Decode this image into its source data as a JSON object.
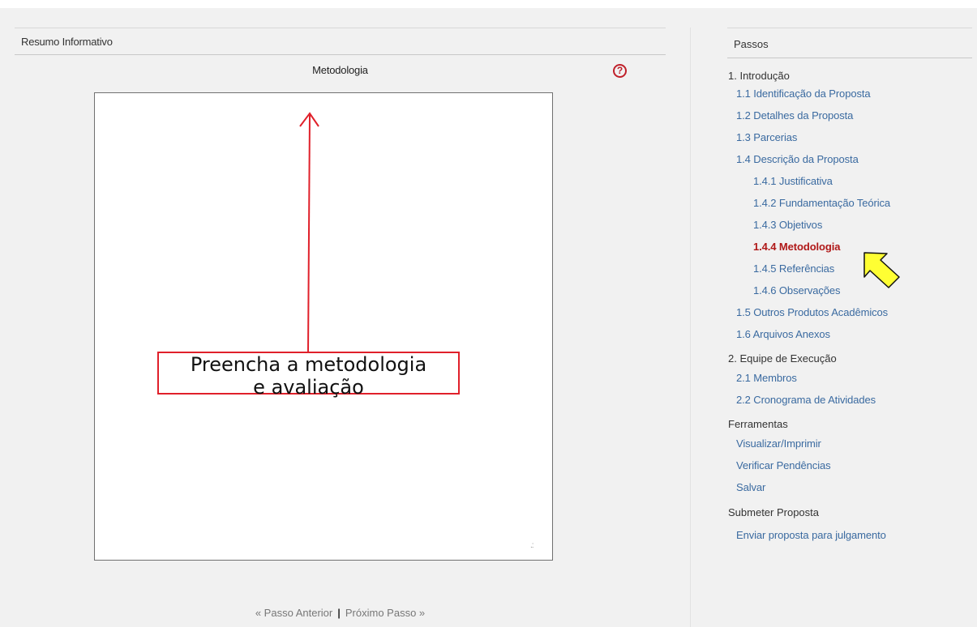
{
  "left_panel": {
    "title": "Resumo Informativo",
    "field_label": "Metodologia",
    "help_icon_glyph": "?",
    "textarea_value": "",
    "resize_grip_glyph": ".:",
    "callout_line1": "Preencha a metodologia",
    "callout_line2": "e avaliação"
  },
  "pager": {
    "prev_label": "« Passo Anterior",
    "separator": "|",
    "next_label": "Próximo Passo »"
  },
  "sidebar": {
    "title": "Passos",
    "section_intro": "1. Introdução",
    "intro_items": [
      "1.1 Identificação da Proposta",
      "1.2 Detalhes da Proposta",
      "1.3 Parcerias",
      "1.4 Descrição da Proposta"
    ],
    "desc_items": [
      "1.4.1 Justificativa",
      "1.4.2 Fundamentação Teórica",
      "1.4.3 Objetivos",
      "1.4.4 Metodologia",
      "1.4.5 Referências",
      "1.4.6 Observações"
    ],
    "intro_tail_items": [
      "1.5 Outros Produtos Acadêmicos",
      "1.6 Arquivos Anexos"
    ],
    "section_team": "2. Equipe de Execução",
    "team_items": [
      "2.1 Membros",
      "2.2 Cronograma de Atividades"
    ],
    "section_tools": "Ferramentas",
    "tool_items": [
      "Visualizar/Imprimir",
      "Verificar Pendências",
      "Salvar"
    ],
    "section_submit": "Submeter Proposta",
    "submit_items": [
      "Enviar proposta para julgamento"
    ]
  },
  "colors": {
    "link": "#3a6aa0",
    "active": "#b01818",
    "callout_border": "#e0202a",
    "pointer_fill": "#ffff33"
  },
  "icons": {
    "help": "help-circle-icon",
    "annotation_arrow": "arrow-up-icon",
    "cursor_pointer": "pointer-arrow-icon"
  }
}
